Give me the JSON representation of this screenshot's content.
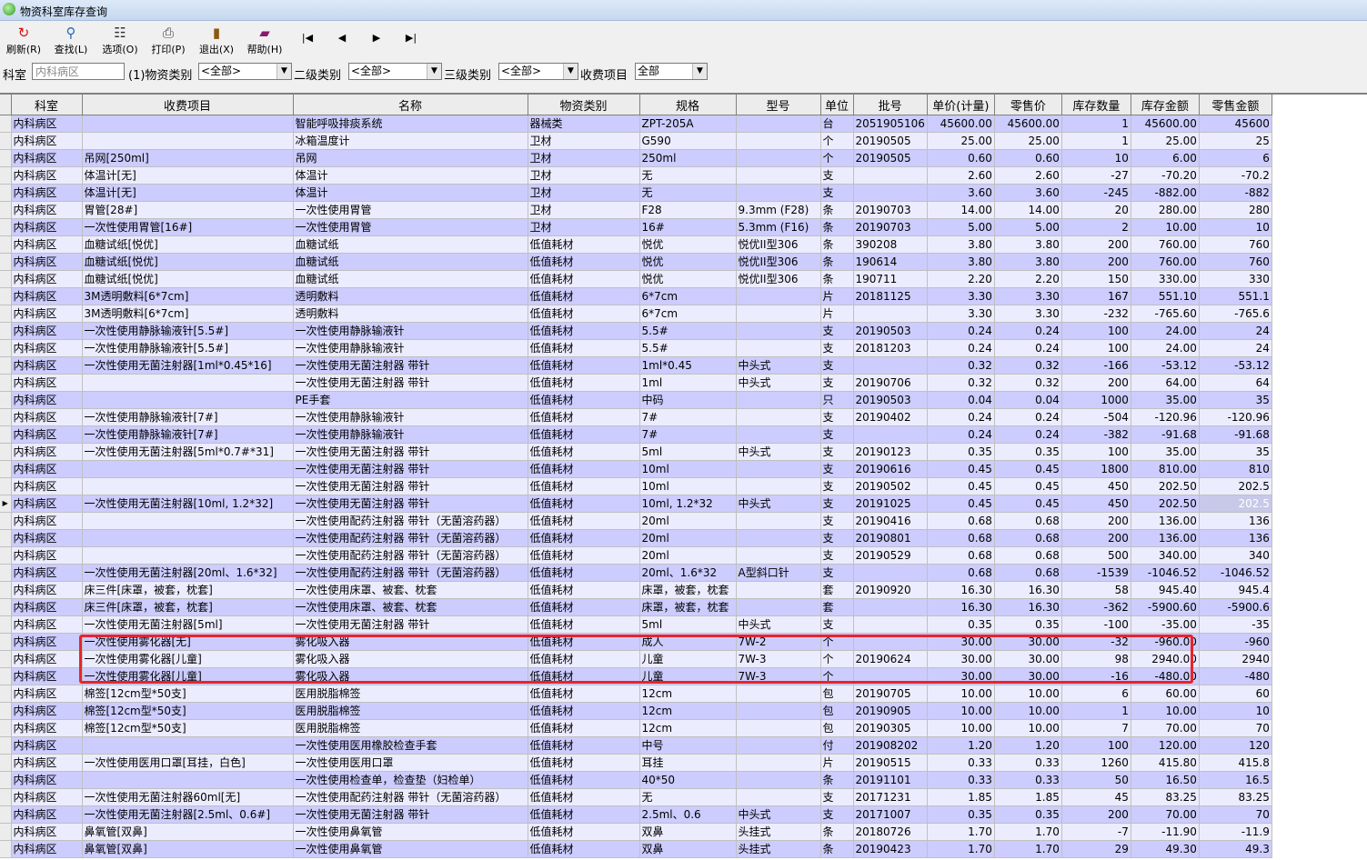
{
  "window": {
    "title": "物资科室库存查询"
  },
  "toolbar": {
    "refresh": "刷新(R)",
    "find": "查找(L)",
    "options": "选项(O)",
    "print": "打印(P)",
    "exit": "退出(X)",
    "help": "帮助(H)"
  },
  "filters": {
    "dept_label": "科室",
    "dept_value": "内科病区",
    "cat1_label": "(1)物资类别",
    "cat1_value": "<全部>",
    "cat2_label": "二级类别",
    "cat2_value": "<全部>",
    "cat3_label": "三级类别",
    "cat3_value": "<全部>",
    "fee_label": "收费项目",
    "fee_value": "全部"
  },
  "table": {
    "columns": [
      "科室",
      "收费项目",
      "名称",
      "物资类别",
      "规格",
      "型号",
      "单位",
      "批号",
      "单价(计量)",
      "零售价",
      "库存数量",
      "库存金额",
      "零售金额"
    ],
    "rows": [
      [
        "内科病区",
        "",
        "智能呼吸排痰系统",
        "器械类",
        "ZPT-205A",
        "",
        "台",
        "2051905106",
        "45600.00",
        "45600.00",
        "1",
        "45600.00",
        "45600"
      ],
      [
        "内科病区",
        "",
        "冰箱温度计",
        "卫材",
        "G590",
        "",
        "个",
        "20190505",
        "25.00",
        "25.00",
        "1",
        "25.00",
        "25"
      ],
      [
        "内科病区",
        "吊网[250ml]",
        "吊网",
        "卫材",
        "250ml",
        "",
        "个",
        "20190505",
        "0.60",
        "0.60",
        "10",
        "6.00",
        "6"
      ],
      [
        "内科病区",
        "体温计[无]",
        "体温计",
        "卫材",
        "无",
        "",
        "支",
        "",
        "2.60",
        "2.60",
        "-27",
        "-70.20",
        "-70.2"
      ],
      [
        "内科病区",
        "体温计[无]",
        "体温计",
        "卫材",
        "无",
        "",
        "支",
        "",
        "3.60",
        "3.60",
        "-245",
        "-882.00",
        "-882"
      ],
      [
        "内科病区",
        "胃管[28#]",
        "一次性使用胃管",
        "卫材",
        "F28",
        "9.3mm (F28)",
        "条",
        "20190703",
        "14.00",
        "14.00",
        "20",
        "280.00",
        "280"
      ],
      [
        "内科病区",
        "一次性使用胃管[16#]",
        "一次性使用胃管",
        "卫材",
        "16#",
        "5.3mm (F16)",
        "条",
        "20190703",
        "5.00",
        "5.00",
        "2",
        "10.00",
        "10"
      ],
      [
        "内科病区",
        "血糖试纸[悦优]",
        "血糖试纸",
        "低值耗材",
        "悦优",
        "悦优II型306",
        "条",
        "390208",
        "3.80",
        "3.80",
        "200",
        "760.00",
        "760"
      ],
      [
        "内科病区",
        "血糖试纸[悦优]",
        "血糖试纸",
        "低值耗材",
        "悦优",
        "悦优II型306",
        "条",
        "190614",
        "3.80",
        "3.80",
        "200",
        "760.00",
        "760"
      ],
      [
        "内科病区",
        "血糖试纸[悦优]",
        "血糖试纸",
        "低值耗材",
        "悦优",
        "悦优II型306",
        "条",
        "190711",
        "2.20",
        "2.20",
        "150",
        "330.00",
        "330"
      ],
      [
        "内科病区",
        "3M透明敷料[6*7cm]",
        "透明敷料",
        "低值耗材",
        "6*7cm",
        "",
        "片",
        "20181125",
        "3.30",
        "3.30",
        "167",
        "551.10",
        "551.1"
      ],
      [
        "内科病区",
        "3M透明敷料[6*7cm]",
        "透明敷料",
        "低值耗材",
        "6*7cm",
        "",
        "片",
        "",
        "3.30",
        "3.30",
        "-232",
        "-765.60",
        "-765.6"
      ],
      [
        "内科病区",
        "一次性使用静脉输液针[5.5#]",
        "一次性使用静脉输液针",
        "低值耗材",
        "5.5#",
        "",
        "支",
        "20190503",
        "0.24",
        "0.24",
        "100",
        "24.00",
        "24"
      ],
      [
        "内科病区",
        "一次性使用静脉输液针[5.5#]",
        "一次性使用静脉输液针",
        "低值耗材",
        "5.5#",
        "",
        "支",
        "20181203",
        "0.24",
        "0.24",
        "100",
        "24.00",
        "24"
      ],
      [
        "内科病区",
        "一次性使用无菌注射器[1ml*0.45*16]",
        "一次性使用无菌注射器 带针",
        "低值耗材",
        "1ml*0.45",
        "中头式",
        "支",
        "",
        "0.32",
        "0.32",
        "-166",
        "-53.12",
        "-53.12"
      ],
      [
        "内科病区",
        "",
        "一次性使用无菌注射器 带针",
        "低值耗材",
        "1ml",
        "中头式",
        "支",
        "20190706",
        "0.32",
        "0.32",
        "200",
        "64.00",
        "64"
      ],
      [
        "内科病区",
        "",
        "PE手套",
        "低值耗材",
        "中码",
        "",
        "只",
        "20190503",
        "0.04",
        "0.04",
        "1000",
        "35.00",
        "35"
      ],
      [
        "内科病区",
        "一次性使用静脉输液针[7#]",
        "一次性使用静脉输液针",
        "低值耗材",
        "7#",
        "",
        "支",
        "20190402",
        "0.24",
        "0.24",
        "-504",
        "-120.96",
        "-120.96"
      ],
      [
        "内科病区",
        "一次性使用静脉输液针[7#]",
        "一次性使用静脉输液针",
        "低值耗材",
        "7#",
        "",
        "支",
        "",
        "0.24",
        "0.24",
        "-382",
        "-91.68",
        "-91.68"
      ],
      [
        "内科病区",
        "一次性使用无菌注射器[5ml*0.7#*31]",
        "一次性使用无菌注射器 带针",
        "低值耗材",
        "5ml",
        "中头式",
        "支",
        "20190123",
        "0.35",
        "0.35",
        "100",
        "35.00",
        "35"
      ],
      [
        "内科病区",
        "",
        "一次性使用无菌注射器 带针",
        "低值耗材",
        "10ml",
        "",
        "支",
        "20190616",
        "0.45",
        "0.45",
        "1800",
        "810.00",
        "810"
      ],
      [
        "内科病区",
        "",
        "一次性使用无菌注射器 带针",
        "低值耗材",
        "10ml",
        "",
        "支",
        "20190502",
        "0.45",
        "0.45",
        "450",
        "202.50",
        "202.5"
      ],
      [
        "内科病区",
        "一次性使用无菌注射器[10ml, 1.2*32]",
        "一次性使用无菌注射器 带针",
        "低值耗材",
        "10ml, 1.2*32",
        "中头式",
        "支",
        "20191025",
        "0.45",
        "0.45",
        "450",
        "202.50",
        "202.5"
      ],
      [
        "内科病区",
        "",
        "一次性使用配药注射器 带针（无菌溶药器）",
        "低值耗材",
        "20ml",
        "",
        "支",
        "20190416",
        "0.68",
        "0.68",
        "200",
        "136.00",
        "136"
      ],
      [
        "内科病区",
        "",
        "一次性使用配药注射器 带针（无菌溶药器）",
        "低值耗材",
        "20ml",
        "",
        "支",
        "20190801",
        "0.68",
        "0.68",
        "200",
        "136.00",
        "136"
      ],
      [
        "内科病区",
        "",
        "一次性使用配药注射器 带针（无菌溶药器）",
        "低值耗材",
        "20ml",
        "",
        "支",
        "20190529",
        "0.68",
        "0.68",
        "500",
        "340.00",
        "340"
      ],
      [
        "内科病区",
        "一次性使用无菌注射器[20ml、1.6*32]",
        "一次性使用配药注射器 带针（无菌溶药器）",
        "低值耗材",
        "20ml、1.6*32",
        "A型斜口针",
        "支",
        "",
        "0.68",
        "0.68",
        "-1539",
        "-1046.52",
        "-1046.52"
      ],
      [
        "内科病区",
        "床三件[床罩，被套，枕套]",
        "一次性使用床罩、被套、枕套",
        "低值耗材",
        "床罩，被套，枕套",
        "",
        "套",
        "20190920",
        "16.30",
        "16.30",
        "58",
        "945.40",
        "945.4"
      ],
      [
        "内科病区",
        "床三件[床罩，被套，枕套]",
        "一次性使用床罩、被套、枕套",
        "低值耗材",
        "床罩，被套，枕套",
        "",
        "套",
        "",
        "16.30",
        "16.30",
        "-362",
        "-5900.60",
        "-5900.6"
      ],
      [
        "内科病区",
        "一次性使用无菌注射器[5ml]",
        "一次性使用无菌注射器 带针",
        "低值耗材",
        "5ml",
        "中头式",
        "支",
        "",
        "0.35",
        "0.35",
        "-100",
        "-35.00",
        "-35"
      ],
      [
        "内科病区",
        "一次性使用雾化器[无]",
        "雾化吸入器",
        "低值耗材",
        "成人",
        "7W-2",
        "个",
        "",
        "30.00",
        "30.00",
        "-32",
        "-960.00",
        "-960"
      ],
      [
        "内科病区",
        "一次性使用雾化器[儿童]",
        "雾化吸入器",
        "低值耗材",
        "儿童",
        "7W-3",
        "个",
        "20190624",
        "30.00",
        "30.00",
        "98",
        "2940.00",
        "2940"
      ],
      [
        "内科病区",
        "一次性使用雾化器[儿童]",
        "雾化吸入器",
        "低值耗材",
        "儿童",
        "7W-3",
        "个",
        "",
        "30.00",
        "30.00",
        "-16",
        "-480.00",
        "-480"
      ],
      [
        "内科病区",
        "棉签[12cm型*50支]",
        "医用脱脂棉签",
        "低值耗材",
        "12cm",
        "",
        "包",
        "20190705",
        "10.00",
        "10.00",
        "6",
        "60.00",
        "60"
      ],
      [
        "内科病区",
        "棉签[12cm型*50支]",
        "医用脱脂棉签",
        "低值耗材",
        "12cm",
        "",
        "包",
        "20190905",
        "10.00",
        "10.00",
        "1",
        "10.00",
        "10"
      ],
      [
        "内科病区",
        "棉签[12cm型*50支]",
        "医用脱脂棉签",
        "低值耗材",
        "12cm",
        "",
        "包",
        "20190305",
        "10.00",
        "10.00",
        "7",
        "70.00",
        "70"
      ],
      [
        "内科病区",
        "",
        "一次性使用医用橡胶检查手套",
        "低值耗材",
        "中号",
        "",
        "付",
        "201908202",
        "1.20",
        "1.20",
        "100",
        "120.00",
        "120"
      ],
      [
        "内科病区",
        "一次性使用医用口罩[耳挂，白色]",
        "一次性使用医用口罩",
        "低值耗材",
        "耳挂",
        "",
        "片",
        "20190515",
        "0.33",
        "0.33",
        "1260",
        "415.80",
        "415.8"
      ],
      [
        "内科病区",
        "",
        "一次性使用检查单，检查垫（妇检单）",
        "低值耗材",
        "40*50",
        "",
        "条",
        "20191101",
        "0.33",
        "0.33",
        "50",
        "16.50",
        "16.5"
      ],
      [
        "内科病区",
        "一次性使用无菌注射器60ml[无]",
        "一次性使用配药注射器 带针（无菌溶药器）",
        "低值耗材",
        "无",
        "",
        "支",
        "20171231",
        "1.85",
        "1.85",
        "45",
        "83.25",
        "83.25"
      ],
      [
        "内科病区",
        "一次性使用无菌注射器[2.5ml、0.6#]",
        "一次性使用无菌注射器 带针",
        "低值耗材",
        "2.5ml、0.6",
        "中头式",
        "支",
        "20171007",
        "0.35",
        "0.35",
        "200",
        "70.00",
        "70"
      ],
      [
        "内科病区",
        "鼻氧管[双鼻]",
        "一次性使用鼻氧管",
        "低值耗材",
        "双鼻",
        "头挂式",
        "条",
        "20180726",
        "1.70",
        "1.70",
        "-7",
        "-11.90",
        "-11.9"
      ],
      [
        "内科病区",
        "鼻氧管[双鼻]",
        "一次性使用鼻氧管",
        "低值耗材",
        "双鼻",
        "头挂式",
        "条",
        "20190423",
        "1.70",
        "1.70",
        "29",
        "49.30",
        "49.3"
      ]
    ],
    "current_row_index": 22
  }
}
